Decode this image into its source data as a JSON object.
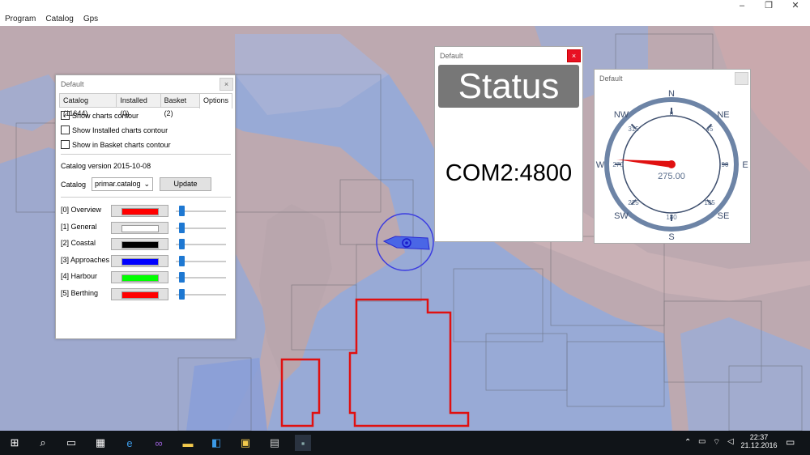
{
  "menu": [
    "Program",
    "Catalog",
    "Gps"
  ],
  "window_controls": {
    "minimize": "–",
    "maximize": "❐",
    "close": "✕"
  },
  "catalog_dialog": {
    "title": "Default",
    "close": "×",
    "tabs": [
      "Catalog (11644)",
      "Installed (0)",
      "Basket (2)",
      "Options"
    ],
    "active_tab": "Options",
    "checkboxes": [
      {
        "label": "Show charts contour",
        "checked": true
      },
      {
        "label": "Show Installed charts contour",
        "checked": false
      },
      {
        "label": "Show in Basket charts contour",
        "checked": false
      }
    ],
    "catalog_version": "Catalog version 2015-10-08",
    "catalog_label": "Catalog",
    "catalog_select": "primar.catalog",
    "update_button": "Update",
    "layers": [
      {
        "label": "[0] Overview",
        "color": "#ff0000"
      },
      {
        "label": "[1] General",
        "color": "#ffffff"
      },
      {
        "label": "[2] Coastal",
        "color": "#000000"
      },
      {
        "label": "[3] Approaches",
        "color": "#0000ff"
      },
      {
        "label": "[4] Harbour",
        "color": "#00ff00"
      },
      {
        "label": "[5] Berthing",
        "color": "#ff0000"
      }
    ]
  },
  "status_dialog": {
    "title": "Default",
    "close": "×",
    "heading": "Status",
    "value": "COM2:4800"
  },
  "compass_dialog": {
    "title": "Default",
    "cardinals": {
      "N": "N",
      "NE": "NE",
      "E": "E",
      "SE": "SE",
      "S": "S",
      "SW": "SW",
      "W": "W",
      "NW": "NW"
    },
    "degrees": [
      "0",
      "45",
      "90",
      "135",
      "180",
      "225",
      "270",
      "315"
    ],
    "heading_value": "275.00",
    "heading": 275
  },
  "taskbar": {
    "time": "22:37",
    "date": "21.12.2016"
  },
  "colors": {
    "land": "#b9a6ad",
    "water_chart": "#97a9d4",
    "accent_red": "#e01010",
    "taskbar": "#101418"
  }
}
